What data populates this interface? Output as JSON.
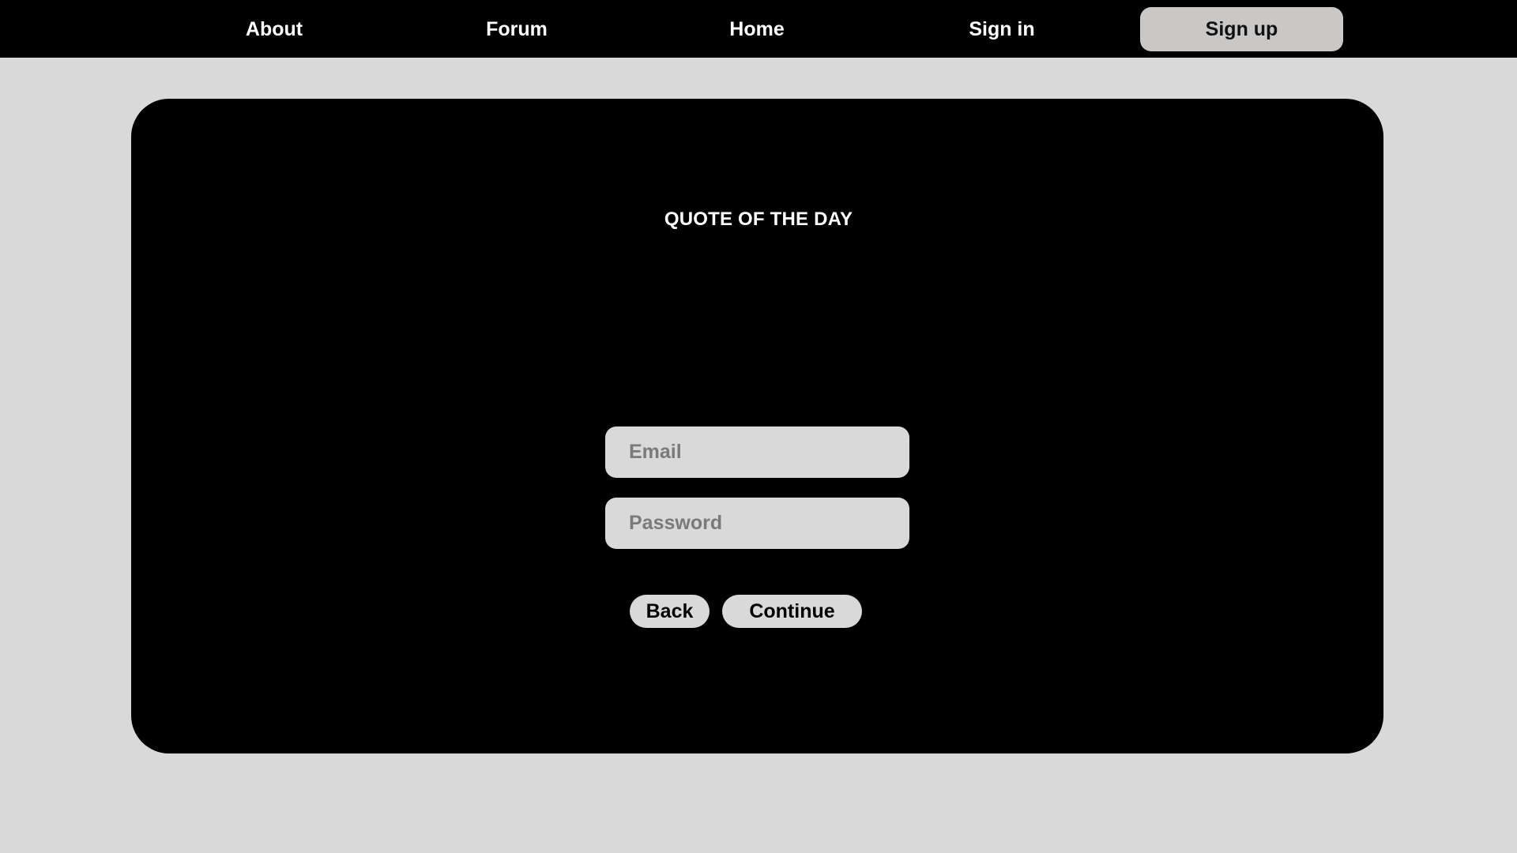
{
  "nav": {
    "items": [
      {
        "label": "About"
      },
      {
        "label": "Forum"
      },
      {
        "label": "Home"
      },
      {
        "label": "Sign in"
      }
    ],
    "signup_label": "Sign up"
  },
  "card": {
    "title": "QUOTE OF THE DAY"
  },
  "form": {
    "email": {
      "value": "",
      "placeholder": "Email"
    },
    "password": {
      "value": "",
      "placeholder": "Password"
    },
    "back_label": "Back",
    "continue_label": "Continue"
  },
  "colors": {
    "background": "#d9d9d9",
    "topbar": "#000000",
    "card": "#000000",
    "signup_button": "#c9c8c6",
    "field": "#d9d9d9",
    "placeholder": "#7a7a7a"
  }
}
